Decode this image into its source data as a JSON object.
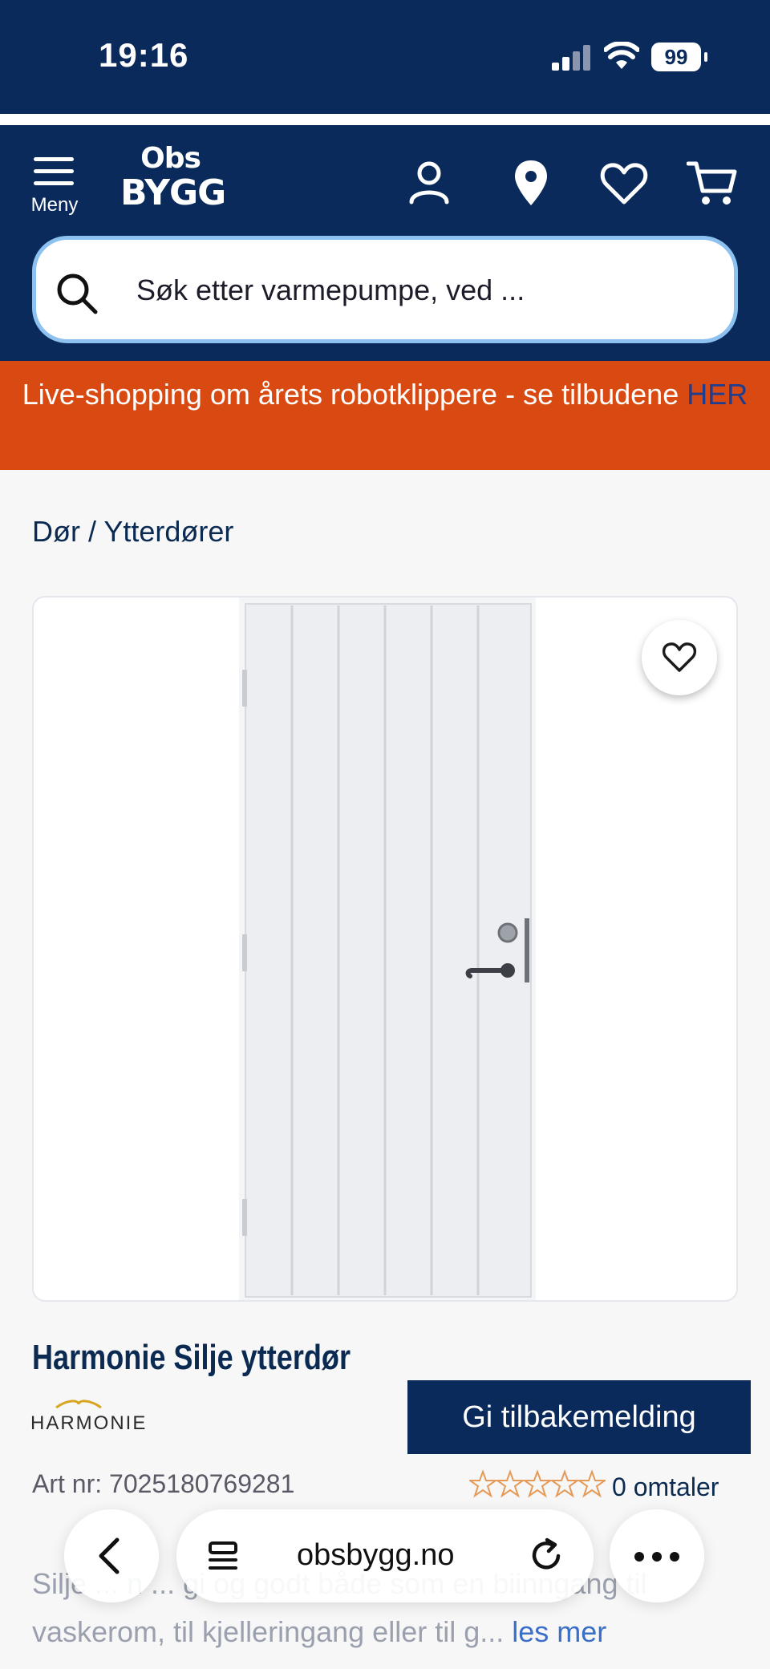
{
  "status": {
    "time": "19:16",
    "battery": "99"
  },
  "header": {
    "menu_label": "Meny",
    "logo_top": "Obs",
    "logo_bottom": "BYGG",
    "search_placeholder": "Søk etter varmepumpe, ved ..."
  },
  "banner": {
    "text": "Live-shopping om årets robotklippere - se tilbudene ",
    "link": "HER"
  },
  "breadcrumb": "Dør / Ytterdører",
  "product": {
    "title": "Harmonie Silje ytterdør",
    "brand": "HARMONIE",
    "art_nr": "Art nr: 7025180769281",
    "reviews": "0 omtaler",
    "rating": 0,
    "description": "Silje ... n ... gi og godt både som en biinngang til vaskerom, til kjelleringang eller til g...",
    "read_more": "les mer"
  },
  "feedback_button": "Gi tilbakemelding",
  "browser": {
    "url": "obsbygg.no"
  },
  "colors": {
    "navy": "#0a2a5c",
    "orange": "#d94a12",
    "star": "#e59a57"
  }
}
